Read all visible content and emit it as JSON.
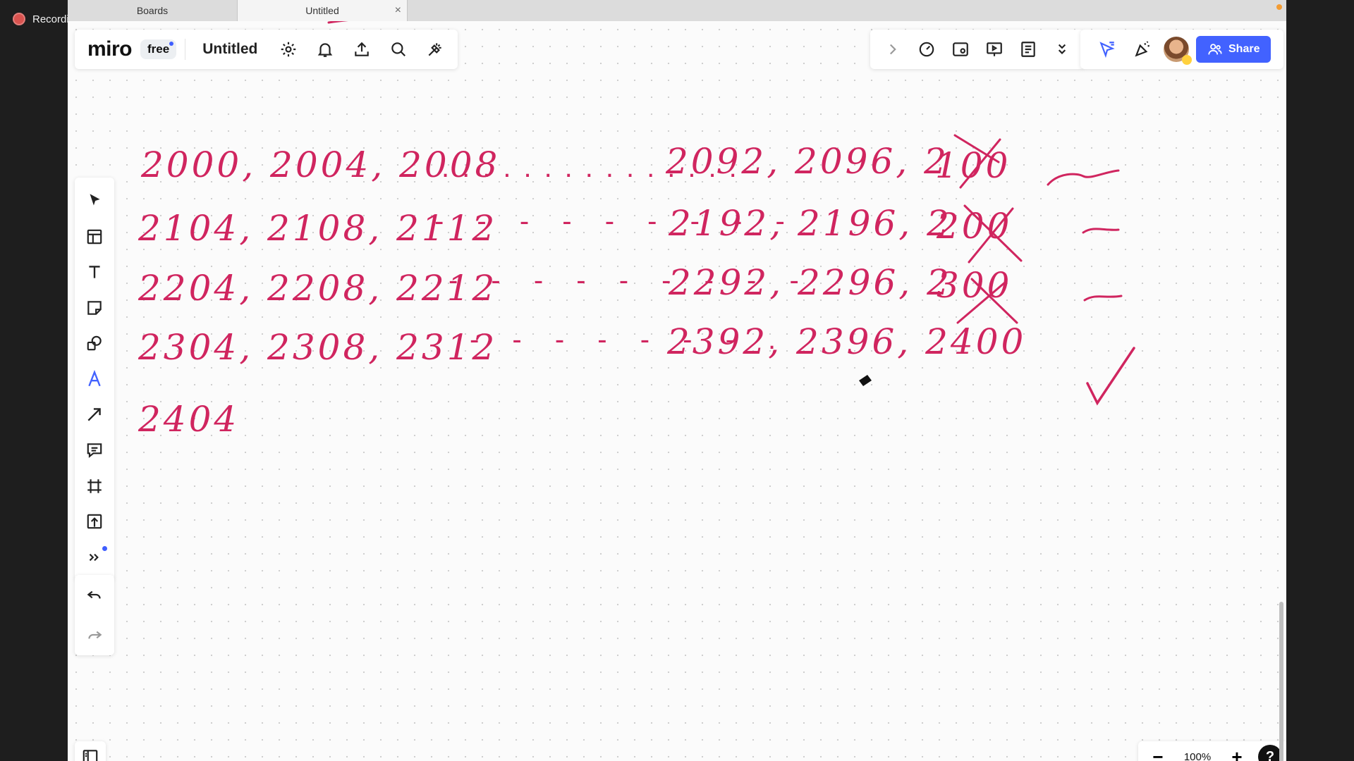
{
  "recording": {
    "label": "Recording"
  },
  "browser_tabs": [
    {
      "label": "Boards",
      "active": false
    },
    {
      "label": "Untitled",
      "active": true,
      "close": "×"
    }
  ],
  "app": {
    "logo": "miro",
    "plan_badge": "free",
    "board_title": "Untitled",
    "share_label": "Share",
    "zoom_level": "100%",
    "help_label": "?",
    "zoom_out": "−",
    "zoom_in": "+",
    "accent_color": "#4262ff",
    "ink_color": "#d0255f"
  },
  "top_icons_left": [
    "settings-icon",
    "bell-icon",
    "upload-icon",
    "search-icon",
    "magic-icon"
  ],
  "top_icons_right": [
    "chevron-right-icon",
    "timer-icon",
    "video-icon",
    "present-icon",
    "notes-icon",
    "more-icon"
  ],
  "collab_icons": [
    "reactions-icon",
    "celebrate-icon",
    "avatar"
  ],
  "left_tools": [
    "select-icon",
    "templates-icon",
    "text-icon",
    "sticky-note-icon",
    "shapes-icon",
    "pen-icon",
    "arrow-icon",
    "comment-icon",
    "frame-icon",
    "upload-icon",
    "more-tools-icon"
  ],
  "handwriting": {
    "row1_start": "2000, 2004, 2008",
    "row1_dots": "...............",
    "row1_end": "2092, 2096, 2",
    "row1_cross": "100",
    "row2_start": "2104, 2108, 2112",
    "row2_dots": "- - - - - - - - -",
    "row2_end": "2192, 2196, 2",
    "row2_cross": "200",
    "row3_start": "2204, 2208, 2212",
    "row3_dots": "- - - - - - - - -",
    "row3_end": "2292, 2296, 2",
    "row3_cross": "300",
    "row4_start": "2304, 2308, 2312",
    "row4_dots": "- - - - - - - .",
    "row4_end": "2392, 2396, 2400",
    "row5": "2404"
  }
}
